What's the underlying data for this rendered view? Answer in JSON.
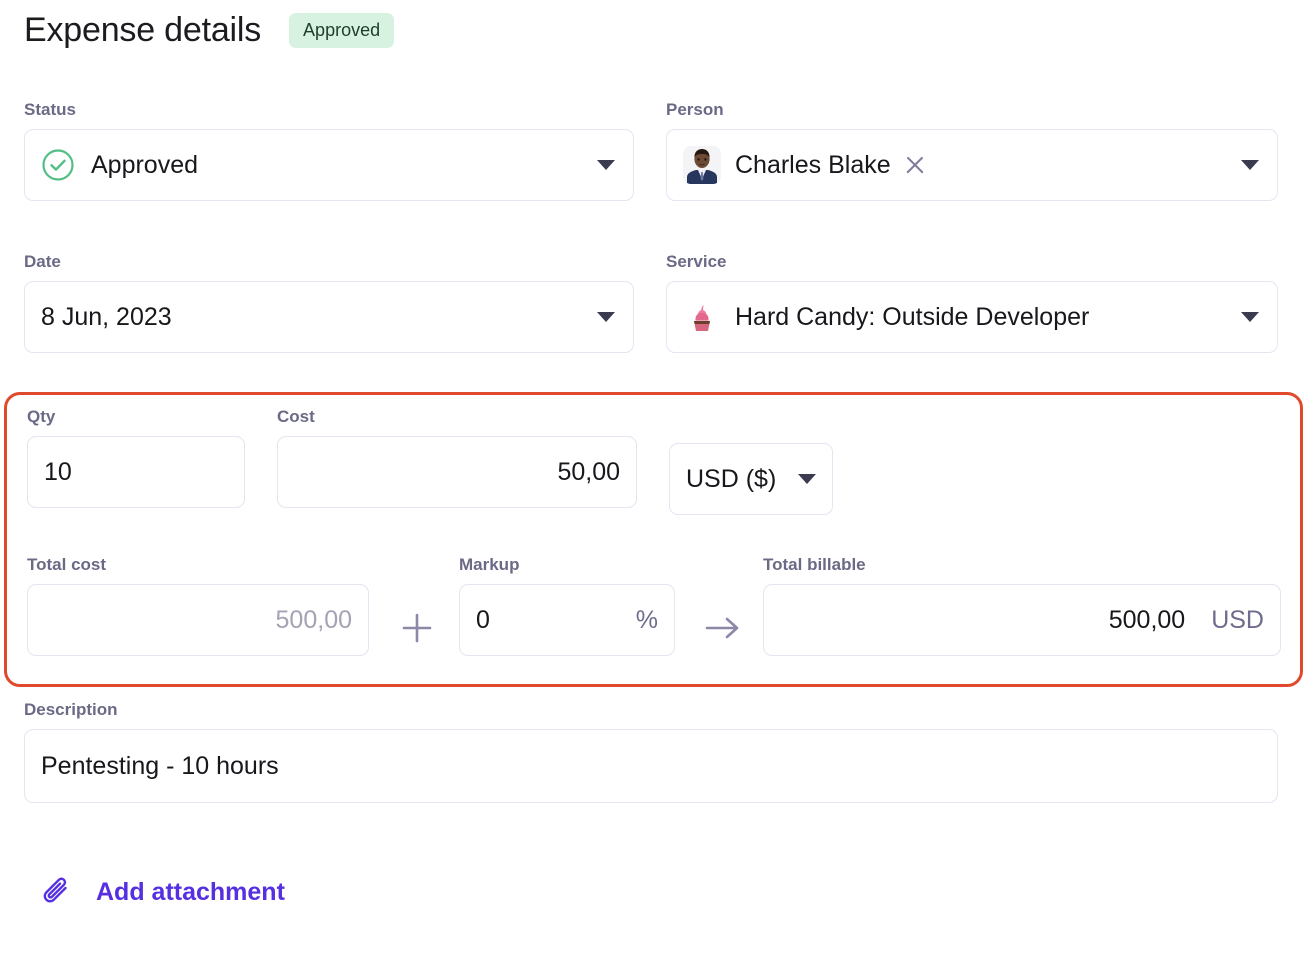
{
  "header": {
    "title": "Expense details",
    "badge": "Approved",
    "badge_bg": "#d7f2e1",
    "badge_color": "#1f3d2b"
  },
  "fields": {
    "status": {
      "label": "Status",
      "value": "Approved",
      "icon": "check-circle-icon",
      "icon_color": "#51bf85",
      "caret": "chevron-down-icon"
    },
    "person": {
      "label": "Person",
      "value": "Charles Blake",
      "avatar": "person-avatar",
      "clear": "close-icon",
      "caret": "chevron-down-icon"
    },
    "date": {
      "label": "Date",
      "value": "8 Jun, 2023",
      "caret": "chevron-down-icon"
    },
    "service": {
      "label": "Service",
      "value": "Hard Candy: Outside Developer",
      "icon": "cupcake-icon",
      "caret": "chevron-down-icon"
    },
    "qty": {
      "label": "Qty",
      "value": "10"
    },
    "cost": {
      "label": "Cost",
      "value": "50,00"
    },
    "currency": {
      "value": "USD ($)",
      "caret": "chevron-down-icon"
    },
    "total_cost": {
      "label": "Total cost",
      "value": "500,00"
    },
    "markup": {
      "label": "Markup",
      "value": "0",
      "suffix": "%"
    },
    "total_billable": {
      "label": "Total billable",
      "value": "500,00",
      "suffix": "USD"
    },
    "description": {
      "label": "Description",
      "value": "Pentesting - 10 hours"
    }
  },
  "operators": {
    "plus": "plus-icon",
    "arrow": "arrow-right-icon"
  },
  "attachment": {
    "label": "Add attachment",
    "icon": "paperclip-icon",
    "color": "#5630e0"
  },
  "highlight": {
    "border_color": "#e04a2b"
  }
}
